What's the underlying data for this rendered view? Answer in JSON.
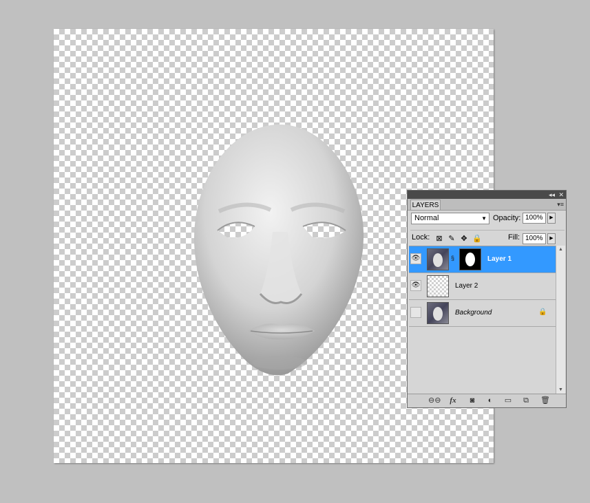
{
  "panel": {
    "tab_label": "LAYERS",
    "titlebar_collapse_glyph": "◂◂",
    "titlebar_close_glyph": "✕",
    "menu_glyph": "▾≡",
    "blend_mode": "Normal",
    "opacity_label": "Opacity:",
    "opacity_value": "100%",
    "lock_label": "Lock:",
    "fill_label": "Fill:",
    "fill_value": "100%",
    "lock_icons": [
      "lock-transparent-pixels-icon",
      "lock-image-pixels-icon",
      "lock-position-icon",
      "lock-all-icon"
    ],
    "layers": [
      {
        "name": "Layer 1",
        "visible": true,
        "selected": true,
        "has_mask": true
      },
      {
        "name": "Layer 2",
        "visible": true,
        "selected": false,
        "has_mask": false
      },
      {
        "name": "Background",
        "visible": false,
        "selected": false,
        "locked": true
      }
    ],
    "bottom_icons": [
      "link-layers-icon",
      "fx-icon",
      "add-mask-icon",
      "adjustment-layer-icon",
      "new-group-icon",
      "new-layer-icon",
      "trash-icon"
    ],
    "fx_text": "fx"
  },
  "colors": {
    "selection": "#3399ff",
    "workspace": "#c0c0c0"
  }
}
